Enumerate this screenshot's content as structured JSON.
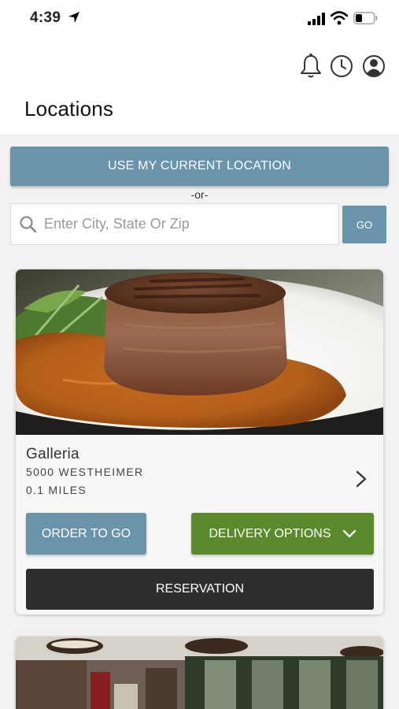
{
  "status_bar": {
    "time": "4:39",
    "icons": [
      "location-arrow-icon",
      "cellular-signal-icon",
      "wifi-icon",
      "battery-icon"
    ]
  },
  "header": {
    "title": "Locations",
    "icons": [
      "bell-icon",
      "clock-icon",
      "account-icon"
    ]
  },
  "location_search": {
    "current_location_label": "USE MY CURRENT LOCATION",
    "or_label": "-or-",
    "placeholder": "Enter City, State Or Zip",
    "value": "",
    "go_label": "GO"
  },
  "locations": [
    {
      "name": "Galleria",
      "address": "5000 WESTHEIMER",
      "distance": "0.1 MILES",
      "order_label": "ORDER TO GO",
      "delivery_label": "DELIVERY OPTIONS",
      "reservation_label": "RESERVATION",
      "photo": "steak-photo"
    },
    {
      "photo": "restaurant-interior-photo"
    }
  ],
  "colors": {
    "accent_blue": "#6a93ac",
    "delivery_green": "#5a8a2c",
    "reservation_dark": "#2e2e2e"
  }
}
